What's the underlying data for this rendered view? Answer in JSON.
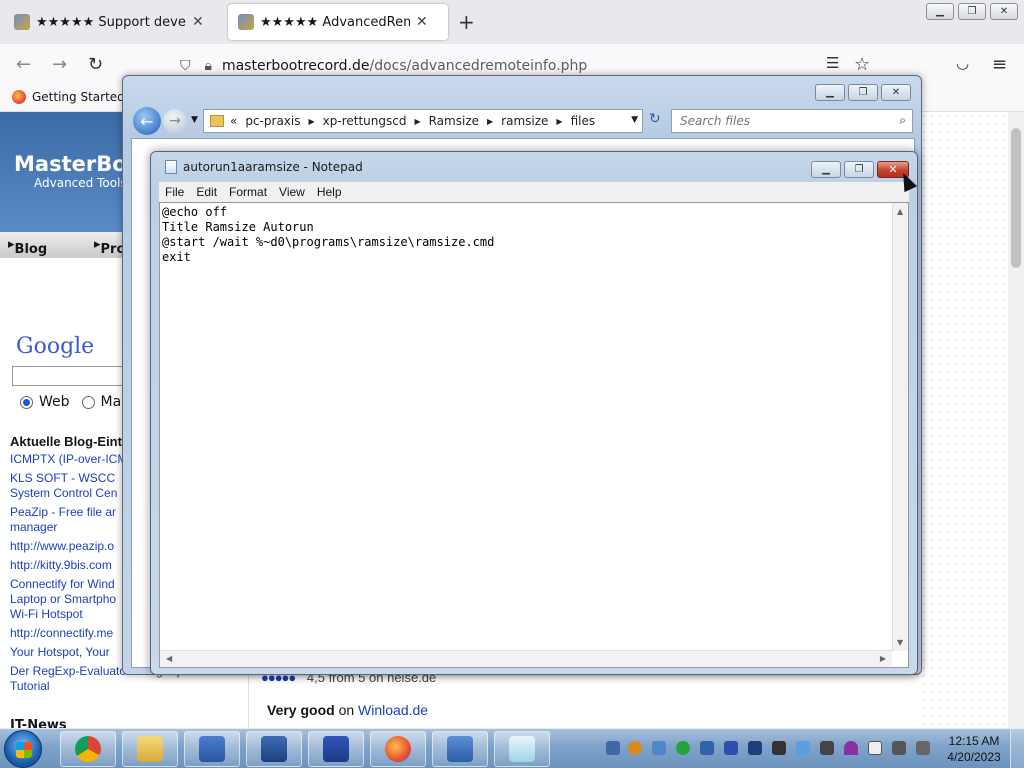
{
  "browser": {
    "tabs": [
      {
        "title": "★★★★★ Support developme",
        "active": false
      },
      {
        "title": "★★★★★ AdvancedRemoteInfo",
        "active": true
      }
    ],
    "url_host": "masterbootrecord.de",
    "url_path": "/docs/advancedremoteinfo.php",
    "bookmark": "Getting Started"
  },
  "webpage": {
    "logo_line1": "MasterBoo",
    "logo_line2": "Advanced Tools",
    "nav": [
      "Blog",
      "Pro"
    ],
    "google": "Google",
    "radio_web": "Web",
    "radio_other": "Mas",
    "blog_heading": "Aktuelle Blog-Eint",
    "blog_items": [
      "ICMPTX (IP-over-ICM",
      "KLS SOFT - WSCC",
      "System Control Cen",
      "PeaZip - Free file ar",
      "manager",
      "http://www.peazip.o",
      "http://kitty.9bis.com",
      "Connectify for Wind",
      "Laptop or Smartpho",
      "Wi-Fi Hotspot",
      "http://connectify.me",
      "Your Hotspot, Your",
      "Der RegExp-Evaluator - RegExp",
      "Tutorial"
    ],
    "it_news": "IT-News",
    "rating_text": "4,5 from 5 on heise.de",
    "rating_stars": "●●●●●",
    "very_good": "Very good",
    "on_text": "on",
    "winload": "Winload.de"
  },
  "explorer": {
    "breadcrumbs": [
      "pc-praxis",
      "xp-rettungscd",
      "Ramsize",
      "ramsize",
      "files"
    ],
    "search_placeholder": "Search files",
    "chevrons": "«"
  },
  "notepad": {
    "title": "autorun1aaramsize - Notepad",
    "menu": [
      "File",
      "Edit",
      "Format",
      "View",
      "Help"
    ],
    "content": "@echo off\nTitle Ramsize Autorun\n@start /wait %~d0\\programs\\ramsize\\ramsize.cmd\nexit"
  },
  "taskbar": {
    "time": "12:15 AM",
    "date": "4/20/2023"
  }
}
